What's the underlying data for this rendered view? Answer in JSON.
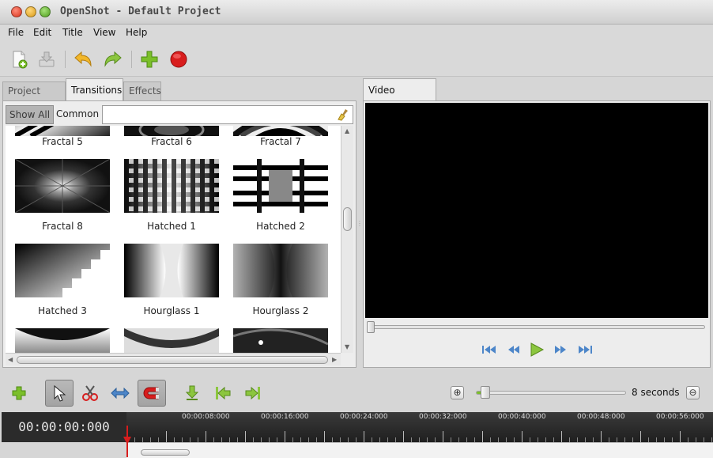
{
  "window": {
    "title": "OpenShot - Default Project"
  },
  "menu": [
    "File",
    "Edit",
    "Title",
    "View",
    "Help"
  ],
  "toolbar": {
    "icons": [
      "new-project-icon",
      "save-project-icon",
      "undo-icon",
      "redo-icon",
      "import-files-icon",
      "record-export-icon"
    ]
  },
  "left_tabs": [
    "Project Files",
    "Transitions",
    "Effects"
  ],
  "active_left_tab": "Transitions",
  "filter": {
    "show_all": "Show All",
    "common": "Common",
    "search_value": ""
  },
  "transitions": [
    {
      "label": "Fractal 5"
    },
    {
      "label": "Fractal 6"
    },
    {
      "label": "Fractal 7"
    },
    {
      "label": "Fractal 8"
    },
    {
      "label": "Hatched 1"
    },
    {
      "label": "Hatched 2"
    },
    {
      "label": "Hatched 3"
    },
    {
      "label": "Hourglass 1"
    },
    {
      "label": "Hourglass 2"
    }
  ],
  "video_preview": {
    "tab": "Video Preview",
    "seek_position": 0.0
  },
  "timeline": {
    "timecode": "00:00:00:000",
    "zoom_label": "8 seconds",
    "zoom_level": 0.06,
    "ruler_labels": [
      "00:00:08:000",
      "00:00:16:000",
      "00:00:24:000",
      "00:00:32:000",
      "00:00:40:000",
      "00:00:48:000",
      "00:00:56:000"
    ]
  },
  "colors": {
    "accent_green": "#7bbf2a",
    "record_red": "#d81d1d",
    "playhead": "#d81d1d"
  }
}
